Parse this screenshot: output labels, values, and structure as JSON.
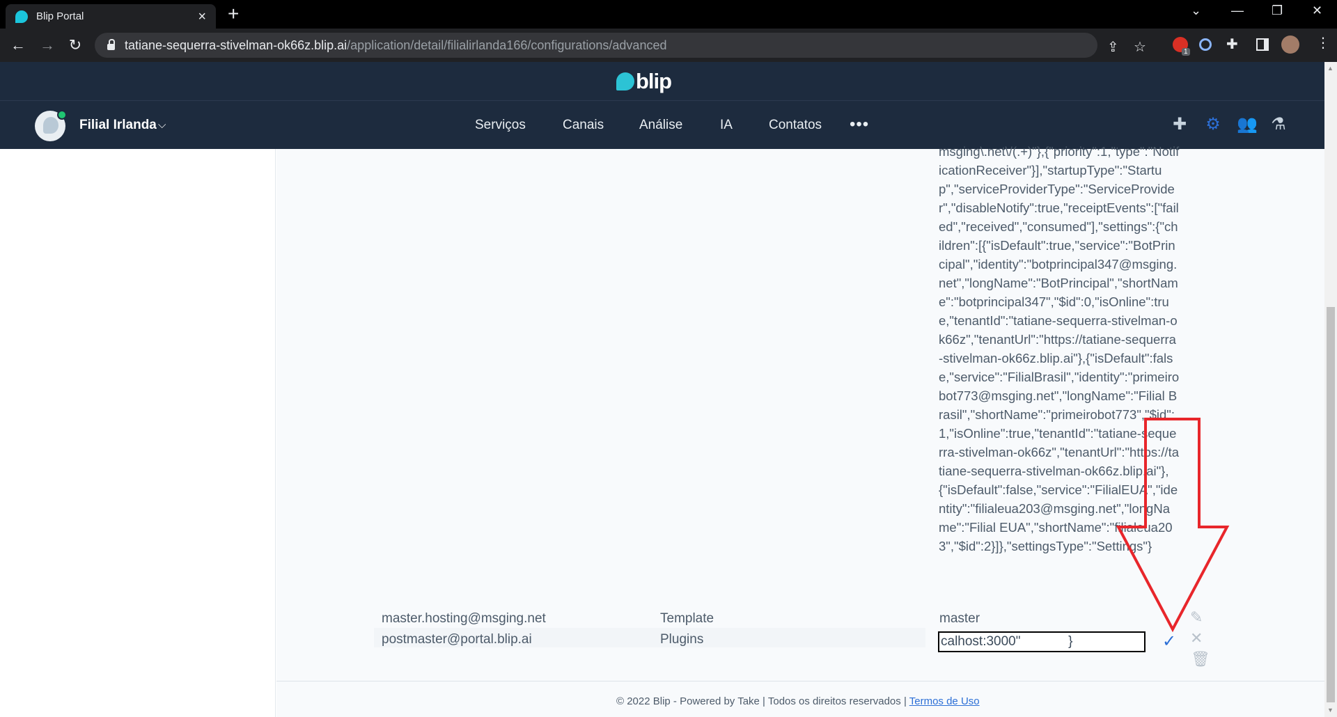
{
  "browser": {
    "tab_title": "Blip Portal",
    "url_host": "tatiane-sequerra-stivelman-ok66z.blip.ai",
    "url_path": "/application/detail/filialirlanda166/configurations/advanced",
    "extension_badge": "1"
  },
  "header": {
    "logo_text": "blip",
    "bot_name": "Filial Irlanda",
    "menu": [
      "Serviços",
      "Canais",
      "Análise",
      "IA",
      "Contatos"
    ],
    "more": "•••"
  },
  "config": {
    "json_value": "msging\\.net\\/(.+)\"},{\"priority\":1,\"type\":\"NotificationReceiver\"}],\"startupType\":\"Startup\",\"serviceProviderType\":\"ServiceProvider\",\"disableNotify\":true,\"receiptEvents\":[\"failed\",\"received\",\"consumed\"],\"settings\":{\"children\":[{\"isDefault\":true,\"service\":\"BotPrincipal\",\"identity\":\"botprincipal347@msging.net\",\"longName\":\"BotPrincipal\",\"shortName\":\"botprincipal347\",\"$id\":0,\"isOnline\":true,\"tenantId\":\"tatiane-sequerra-stivelman-ok66z\",\"tenantUrl\":\"https://tatiane-sequerra-stivelman-ok66z.blip.ai\"},{\"isDefault\":false,\"service\":\"FilialBrasil\",\"identity\":\"primeirobot773@msging.net\",\"longName\":\"Filial Brasil\",\"shortName\":\"primeirobot773\",\"$id\":1,\"isOnline\":true,\"tenantId\":\"tatiane-sequerra-stivelman-ok66z\",\"tenantUrl\":\"https://tatiane-sequerra-stivelman-ok66z.blip.ai\"},{\"isDefault\":false,\"service\":\"FilialEUA\",\"identity\":\"filialeua203@msging.net\",\"longName\":\"Filial EUA\",\"shortName\":\"filialeua203\",\"$id\":2}]},\"settingsType\":\"Settings\"}",
    "rows": [
      {
        "domain": "master.hosting@msging.net",
        "name": "Template",
        "value": "master"
      },
      {
        "domain": "postmaster@portal.blip.ai",
        "name": "Plugins",
        "value": "calhost:3000\"             }"
      }
    ]
  },
  "footer": {
    "text": "© 2022 Blip - Powered by Take | Todos os direitos reservados | ",
    "link": "Termos de Uso"
  },
  "colors": {
    "header_bg": "#1d2b3e",
    "accent": "#2c6fd6",
    "annotation": "#e8262b"
  }
}
